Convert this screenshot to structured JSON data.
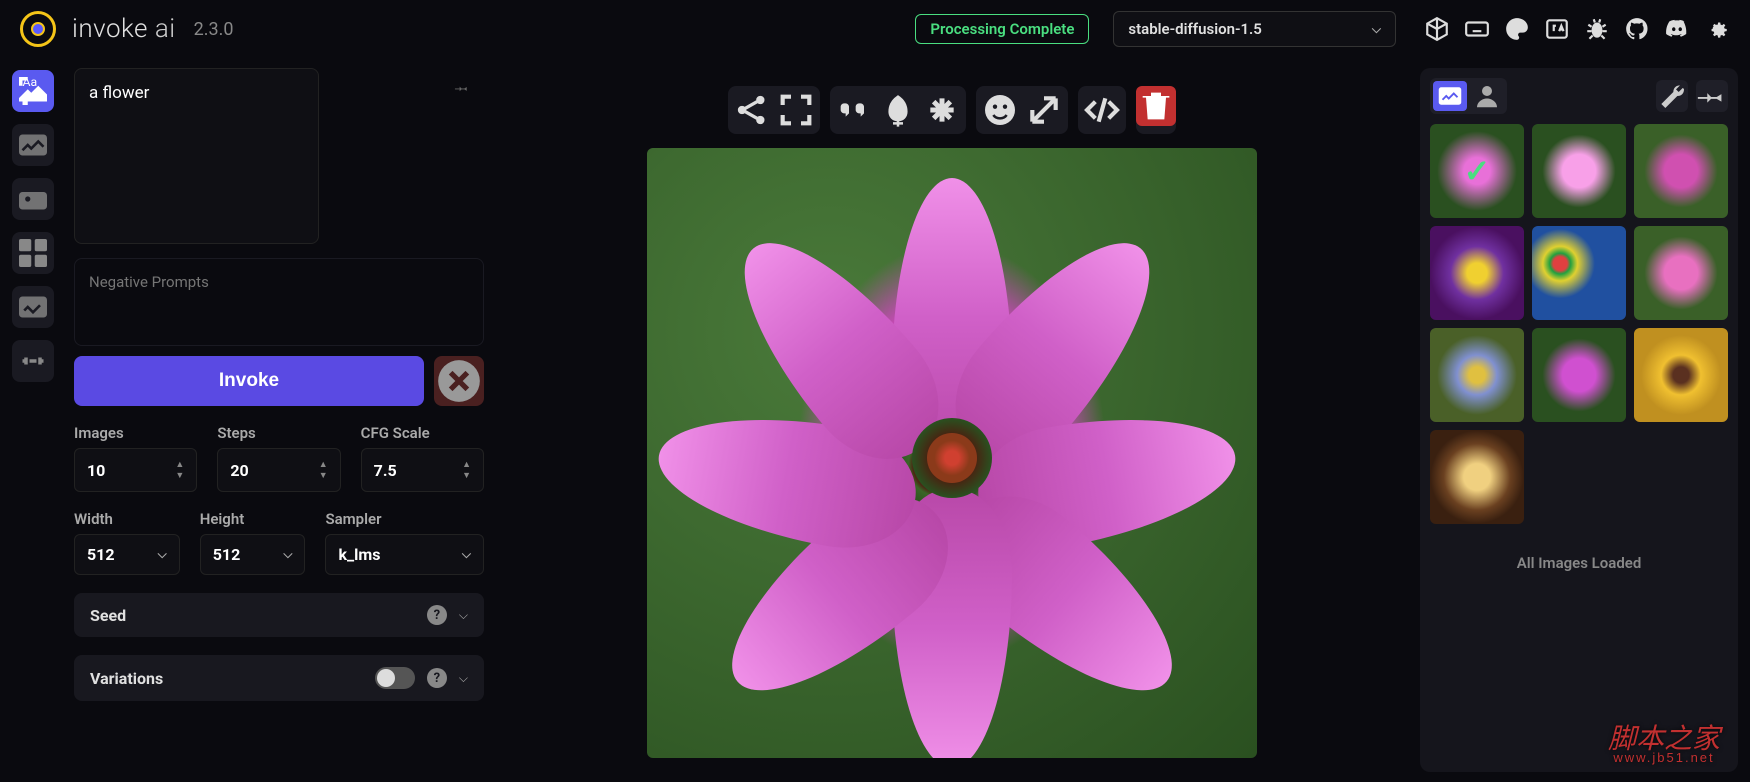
{
  "header": {
    "brand_primary": "invoke",
    "brand_secondary": "ai",
    "version": "2.3.0",
    "status": "Processing Complete",
    "model": "stable-diffusion-1.5",
    "icons": [
      "cube-icon",
      "keyboard-icon",
      "palette-icon",
      "language-icon",
      "bug-icon",
      "github-icon",
      "discord-icon",
      "gear-icon"
    ]
  },
  "nav": {
    "items": [
      "text-to-image-icon",
      "image-to-image-icon",
      "unified-canvas-icon",
      "nodes-icon",
      "post-process-icon",
      "training-icon"
    ]
  },
  "prompt": {
    "positive": "a flower",
    "negative_placeholder": "Negative Prompts"
  },
  "actions": {
    "invoke_label": "Invoke"
  },
  "params": {
    "images": {
      "label": "Images",
      "value": "10"
    },
    "steps": {
      "label": "Steps",
      "value": "20"
    },
    "cfg": {
      "label": "CFG Scale",
      "value": "7.5"
    },
    "width": {
      "label": "Width",
      "value": "512"
    },
    "height": {
      "label": "Height",
      "value": "512"
    },
    "sampler": {
      "label": "Sampler",
      "value": "k_lms"
    }
  },
  "accordions": {
    "seed": "Seed",
    "variations": "Variations"
  },
  "canvas_toolbar": {
    "g1": [
      "share-icon",
      "expand-icon"
    ],
    "g2": [
      "quote-icon",
      "seed-icon",
      "asterisk-icon"
    ],
    "g3": [
      "face-icon",
      "upscale-icon"
    ],
    "g4": [
      "code-icon"
    ],
    "g5": [
      "trash-icon"
    ]
  },
  "gallery": {
    "footer": "All Images Loaded",
    "thumbs": [
      {
        "bg": "radial-gradient(circle, #e870d8 20%, #2a5020 60%)",
        "selected": true
      },
      {
        "bg": "radial-gradient(circle, #f8a0e8 25%, #2a5020 55%)"
      },
      {
        "bg": "radial-gradient(circle, #d050b0 25%, #3a6028 55%)"
      },
      {
        "bg": "radial-gradient(circle, #f0d030 15%, #7030a0 40%, #4a1060 70%)"
      },
      {
        "bg": "radial-gradient(circle at 30% 40%, #e04040 8%, #20a040 12%, #e0d030 20%, #2050a0 40%)"
      },
      {
        "bg": "radial-gradient(circle, #e870c0 25%, #3a6028 55%)"
      },
      {
        "bg": "radial-gradient(circle, #e0c040 12%, #8090d0 30%, #4a6028 60%)"
      },
      {
        "bg": "radial-gradient(circle, #d050d0 25%, #2a5020 55%)"
      },
      {
        "bg": "radial-gradient(circle, #5a3020 12%, #f0c030 30%, #c09020 60%)"
      },
      {
        "bg": "radial-gradient(circle, #f0d080 20%, #6a4020 50%, #3a2010 70%)"
      }
    ]
  },
  "watermark": {
    "main": "脚本之家",
    "sub": "www.jb51.net"
  }
}
